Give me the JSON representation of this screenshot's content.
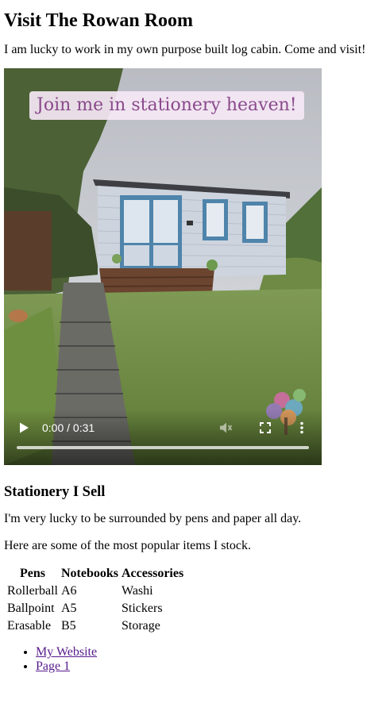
{
  "heading": "Visit The Rowan Room",
  "intro": "I am lucky to work in my own purpose built log cabin. Come and visit!",
  "video": {
    "overlay_text": "Join me in stationery heaven!",
    "time_display": "0:00 / 0:31",
    "progress": 0,
    "icons": [
      "play-icon",
      "mute-icon",
      "fullscreen-icon",
      "more-options-icon"
    ]
  },
  "section2": {
    "heading": "Stationery I Sell",
    "p1": "I'm very lucky to be surrounded by pens and paper all day.",
    "p2": "Here are some of the most popular items I stock."
  },
  "table": {
    "headers": [
      "Pens",
      "Notebooks",
      "Accessories"
    ],
    "rows": [
      [
        "Rollerball",
        "A6",
        "Washi"
      ],
      [
        "Ballpoint",
        "A5",
        "Stickers"
      ],
      [
        "Erasable",
        "B5",
        "Storage"
      ]
    ]
  },
  "links": [
    "My Website",
    "Page 1"
  ],
  "colors": {
    "link_visited": "#551a8b",
    "overlay_text": "#8a4a8c",
    "overlay_bg": "#f5e8f5"
  }
}
